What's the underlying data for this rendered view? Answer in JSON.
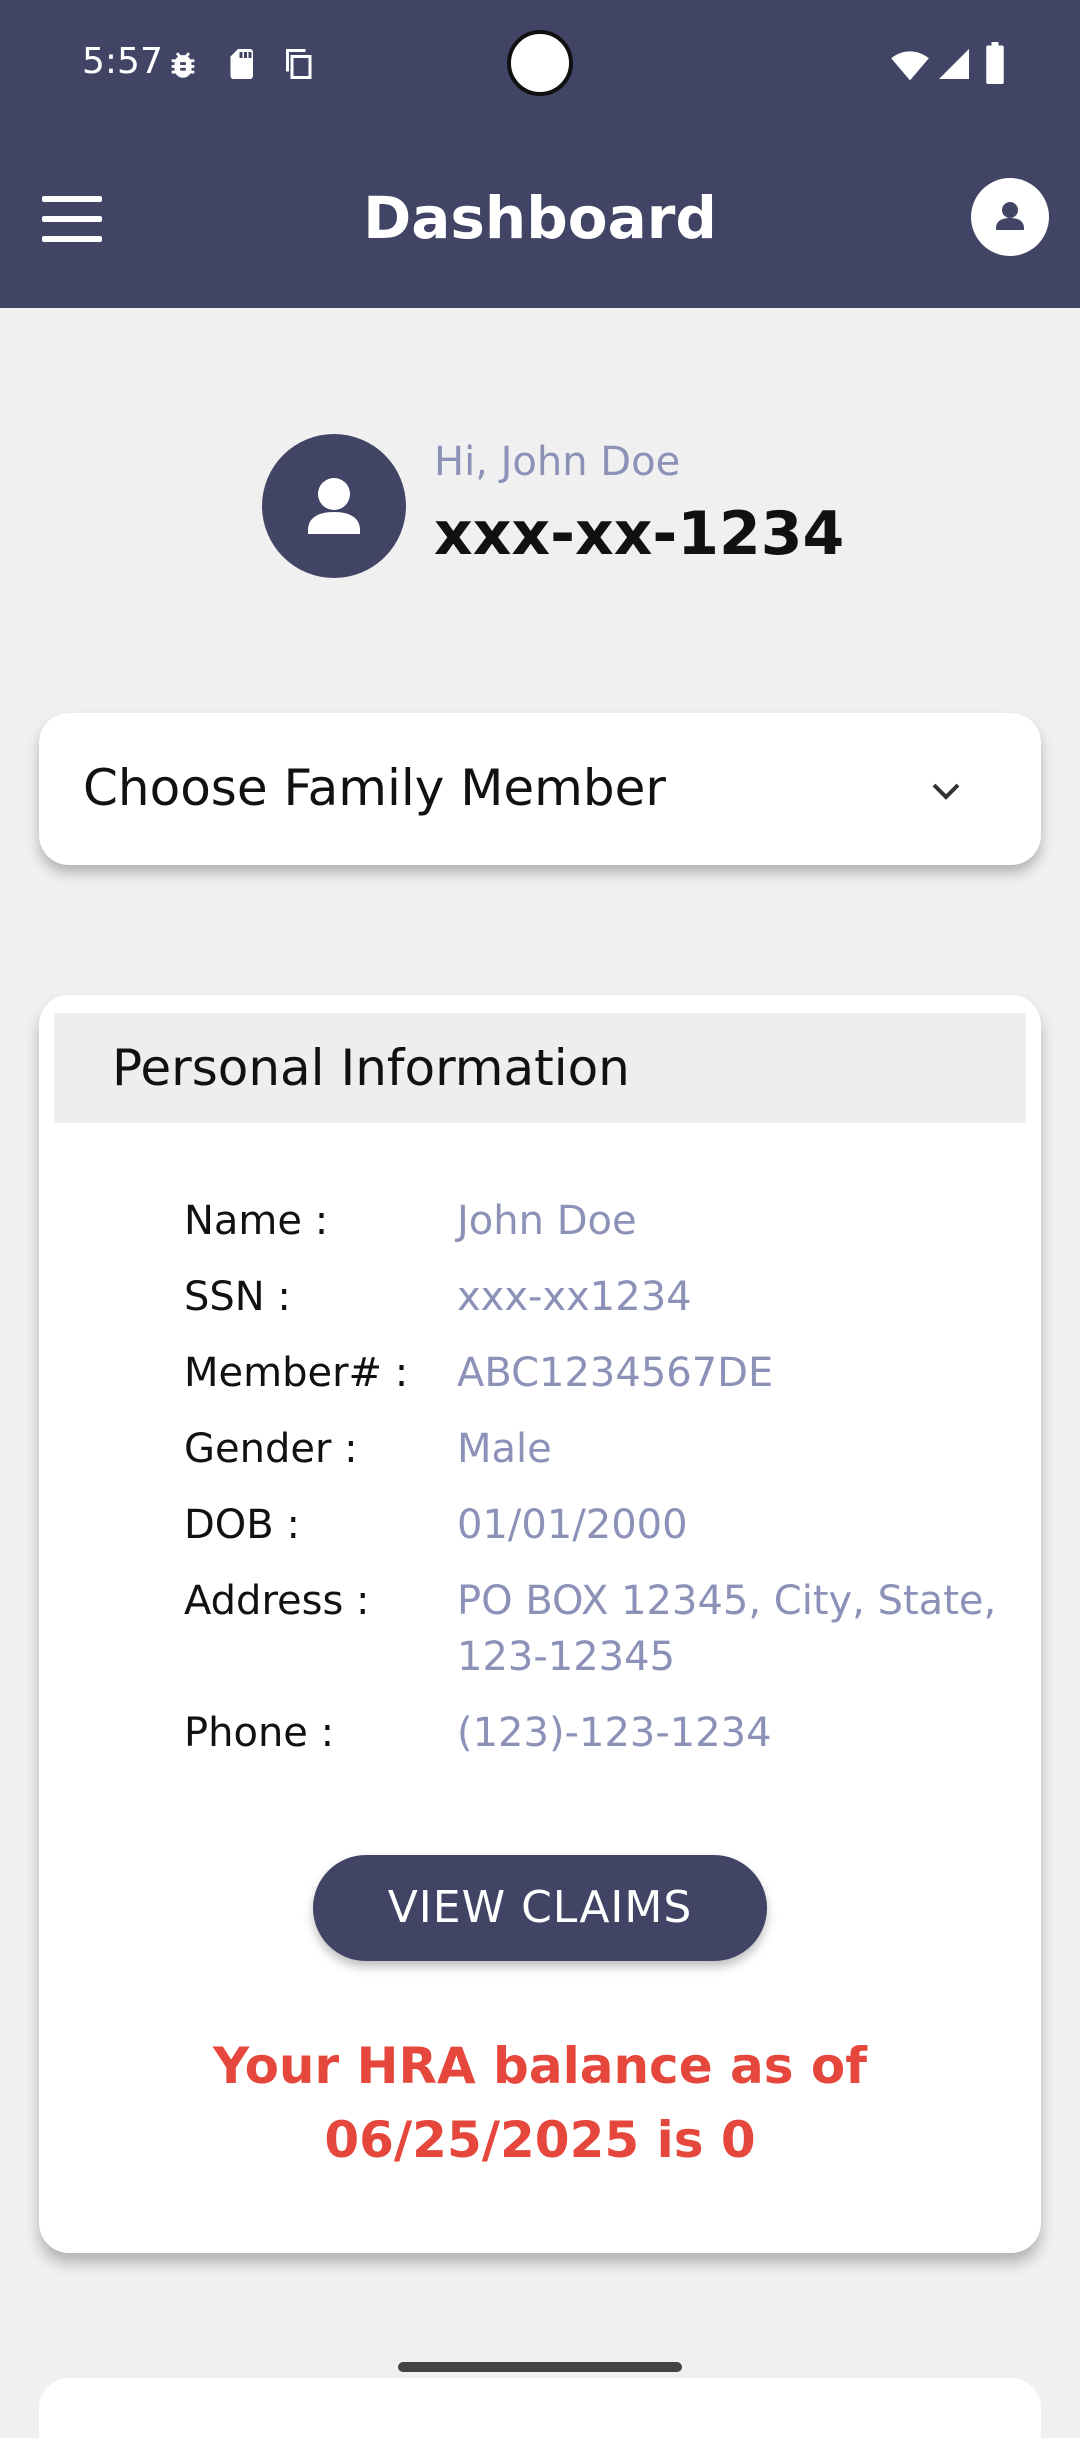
{
  "status_bar": {
    "time": "5:57",
    "left_icons": [
      "bug-icon",
      "sd-card-icon",
      "copy-icon"
    ],
    "right_icons": [
      "wifi-icon",
      "signal-icon",
      "battery-icon"
    ]
  },
  "app_bar": {
    "title": "Dashboard",
    "left_icon": "hamburger-menu-icon",
    "right_icon": "account-icon"
  },
  "greeting": {
    "text": "Hi, John Doe",
    "masked_ssn": "xxx-xx-1234"
  },
  "family_selector": {
    "label": "Choose Family Member",
    "icon": "chevron-down-icon"
  },
  "personal_information": {
    "title": "Personal Information",
    "rows": [
      {
        "label": "Name :",
        "value": "John Doe"
      },
      {
        "label": "SSN :",
        "value": "xxx-xx1234"
      },
      {
        "label": "Member# :",
        "value": "ABC1234567DE"
      },
      {
        "label": "Gender :",
        "value": "Male"
      },
      {
        "label": "DOB :",
        "value": "01/01/2000"
      },
      {
        "label": "Address :",
        "value": "PO BOX 12345, City, State, 123-12345"
      },
      {
        "label": "Phone :",
        "value": "(123)-123-1234"
      }
    ],
    "view_claims_label": "VIEW CLAIMS",
    "hra_balance_text": "Your HRA balance as of 06/25/2025 is 0"
  },
  "colors": {
    "primary": "#414465",
    "background": "#f0f0f0",
    "accent_text": "#8c91b8",
    "alert": "#e5473c"
  }
}
